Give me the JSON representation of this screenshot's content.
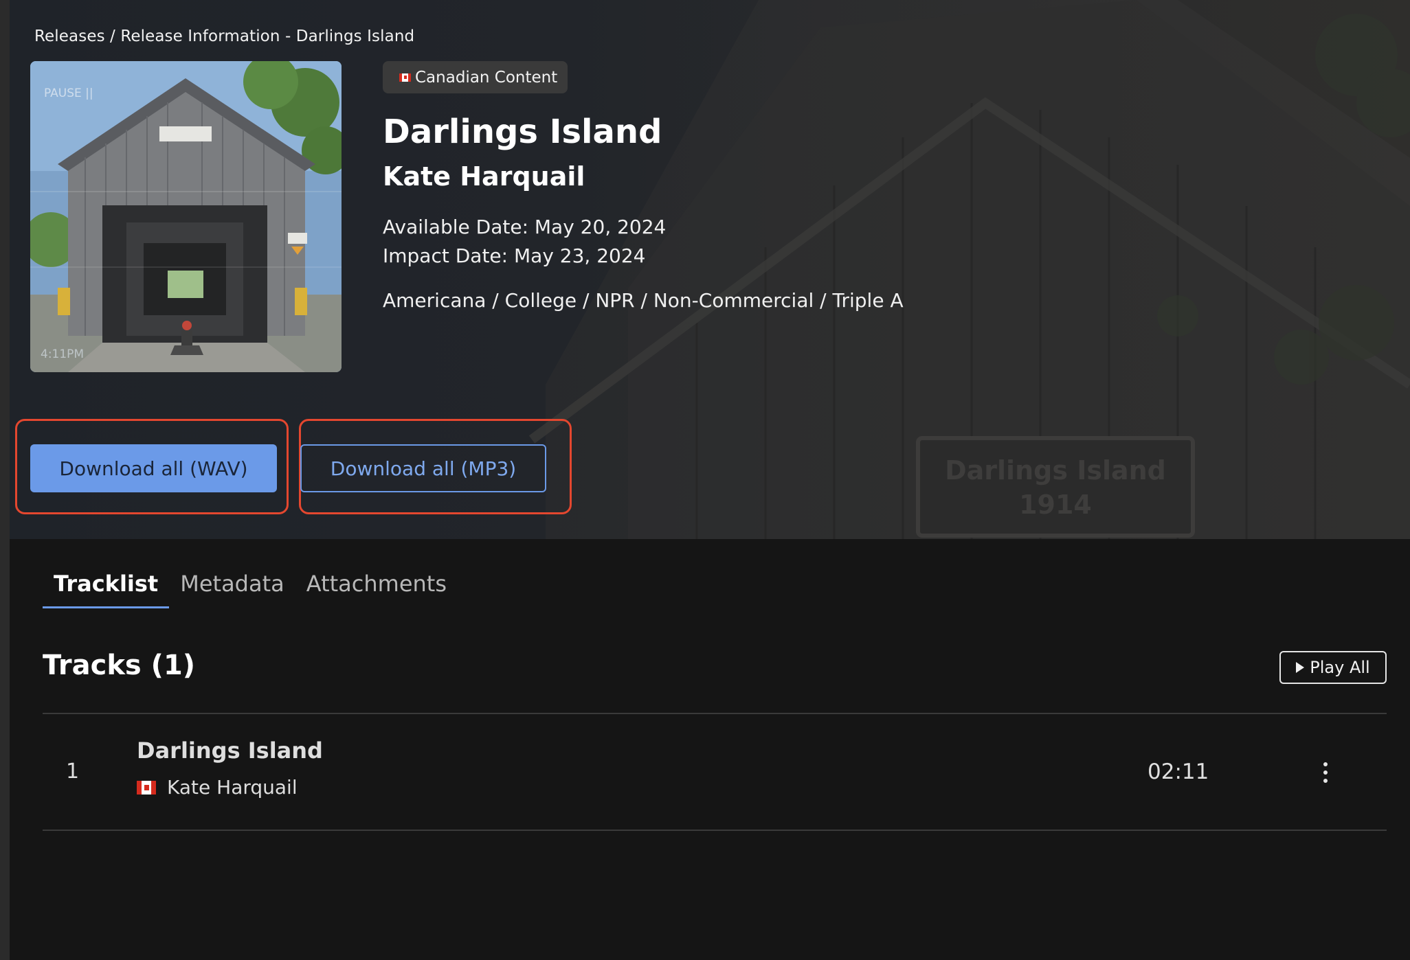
{
  "breadcrumb": "Releases / Release Information - Darlings Island",
  "release": {
    "badge": "Canadian Content",
    "title": "Darlings Island",
    "artist": "Kate Harquail",
    "available_date": "Available Date: May 20, 2024",
    "impact_date": "Impact Date: May 23, 2024",
    "formats": "Americana / College / NPR / Non-Commercial / Triple A",
    "cover_overlay_top": "PAUSE ||",
    "cover_overlay_bottom": "4:11PM",
    "background_sign_line1": "Darlings Island",
    "background_sign_line2": "1914"
  },
  "actions": {
    "download_wav": "Download all (WAV)",
    "download_mp3": "Download all (MP3)"
  },
  "tabs": [
    {
      "label": "Tracklist",
      "active": true
    },
    {
      "label": "Metadata",
      "active": false
    },
    {
      "label": "Attachments",
      "active": false
    }
  ],
  "tracks": {
    "heading": "Tracks (1)",
    "play_all": "Play All",
    "items": [
      {
        "number": "1",
        "title": "Darlings Island",
        "artist": "Kate Harquail",
        "duration": "02:11"
      }
    ]
  },
  "colors": {
    "accent": "#6b9ae8",
    "highlight": "#e4472f",
    "background": "#151515",
    "flag_red": "#d52b1e"
  },
  "icons": {
    "flag": "canada-flag-icon",
    "play": "play-icon",
    "menu": "kebab-menu-icon"
  }
}
